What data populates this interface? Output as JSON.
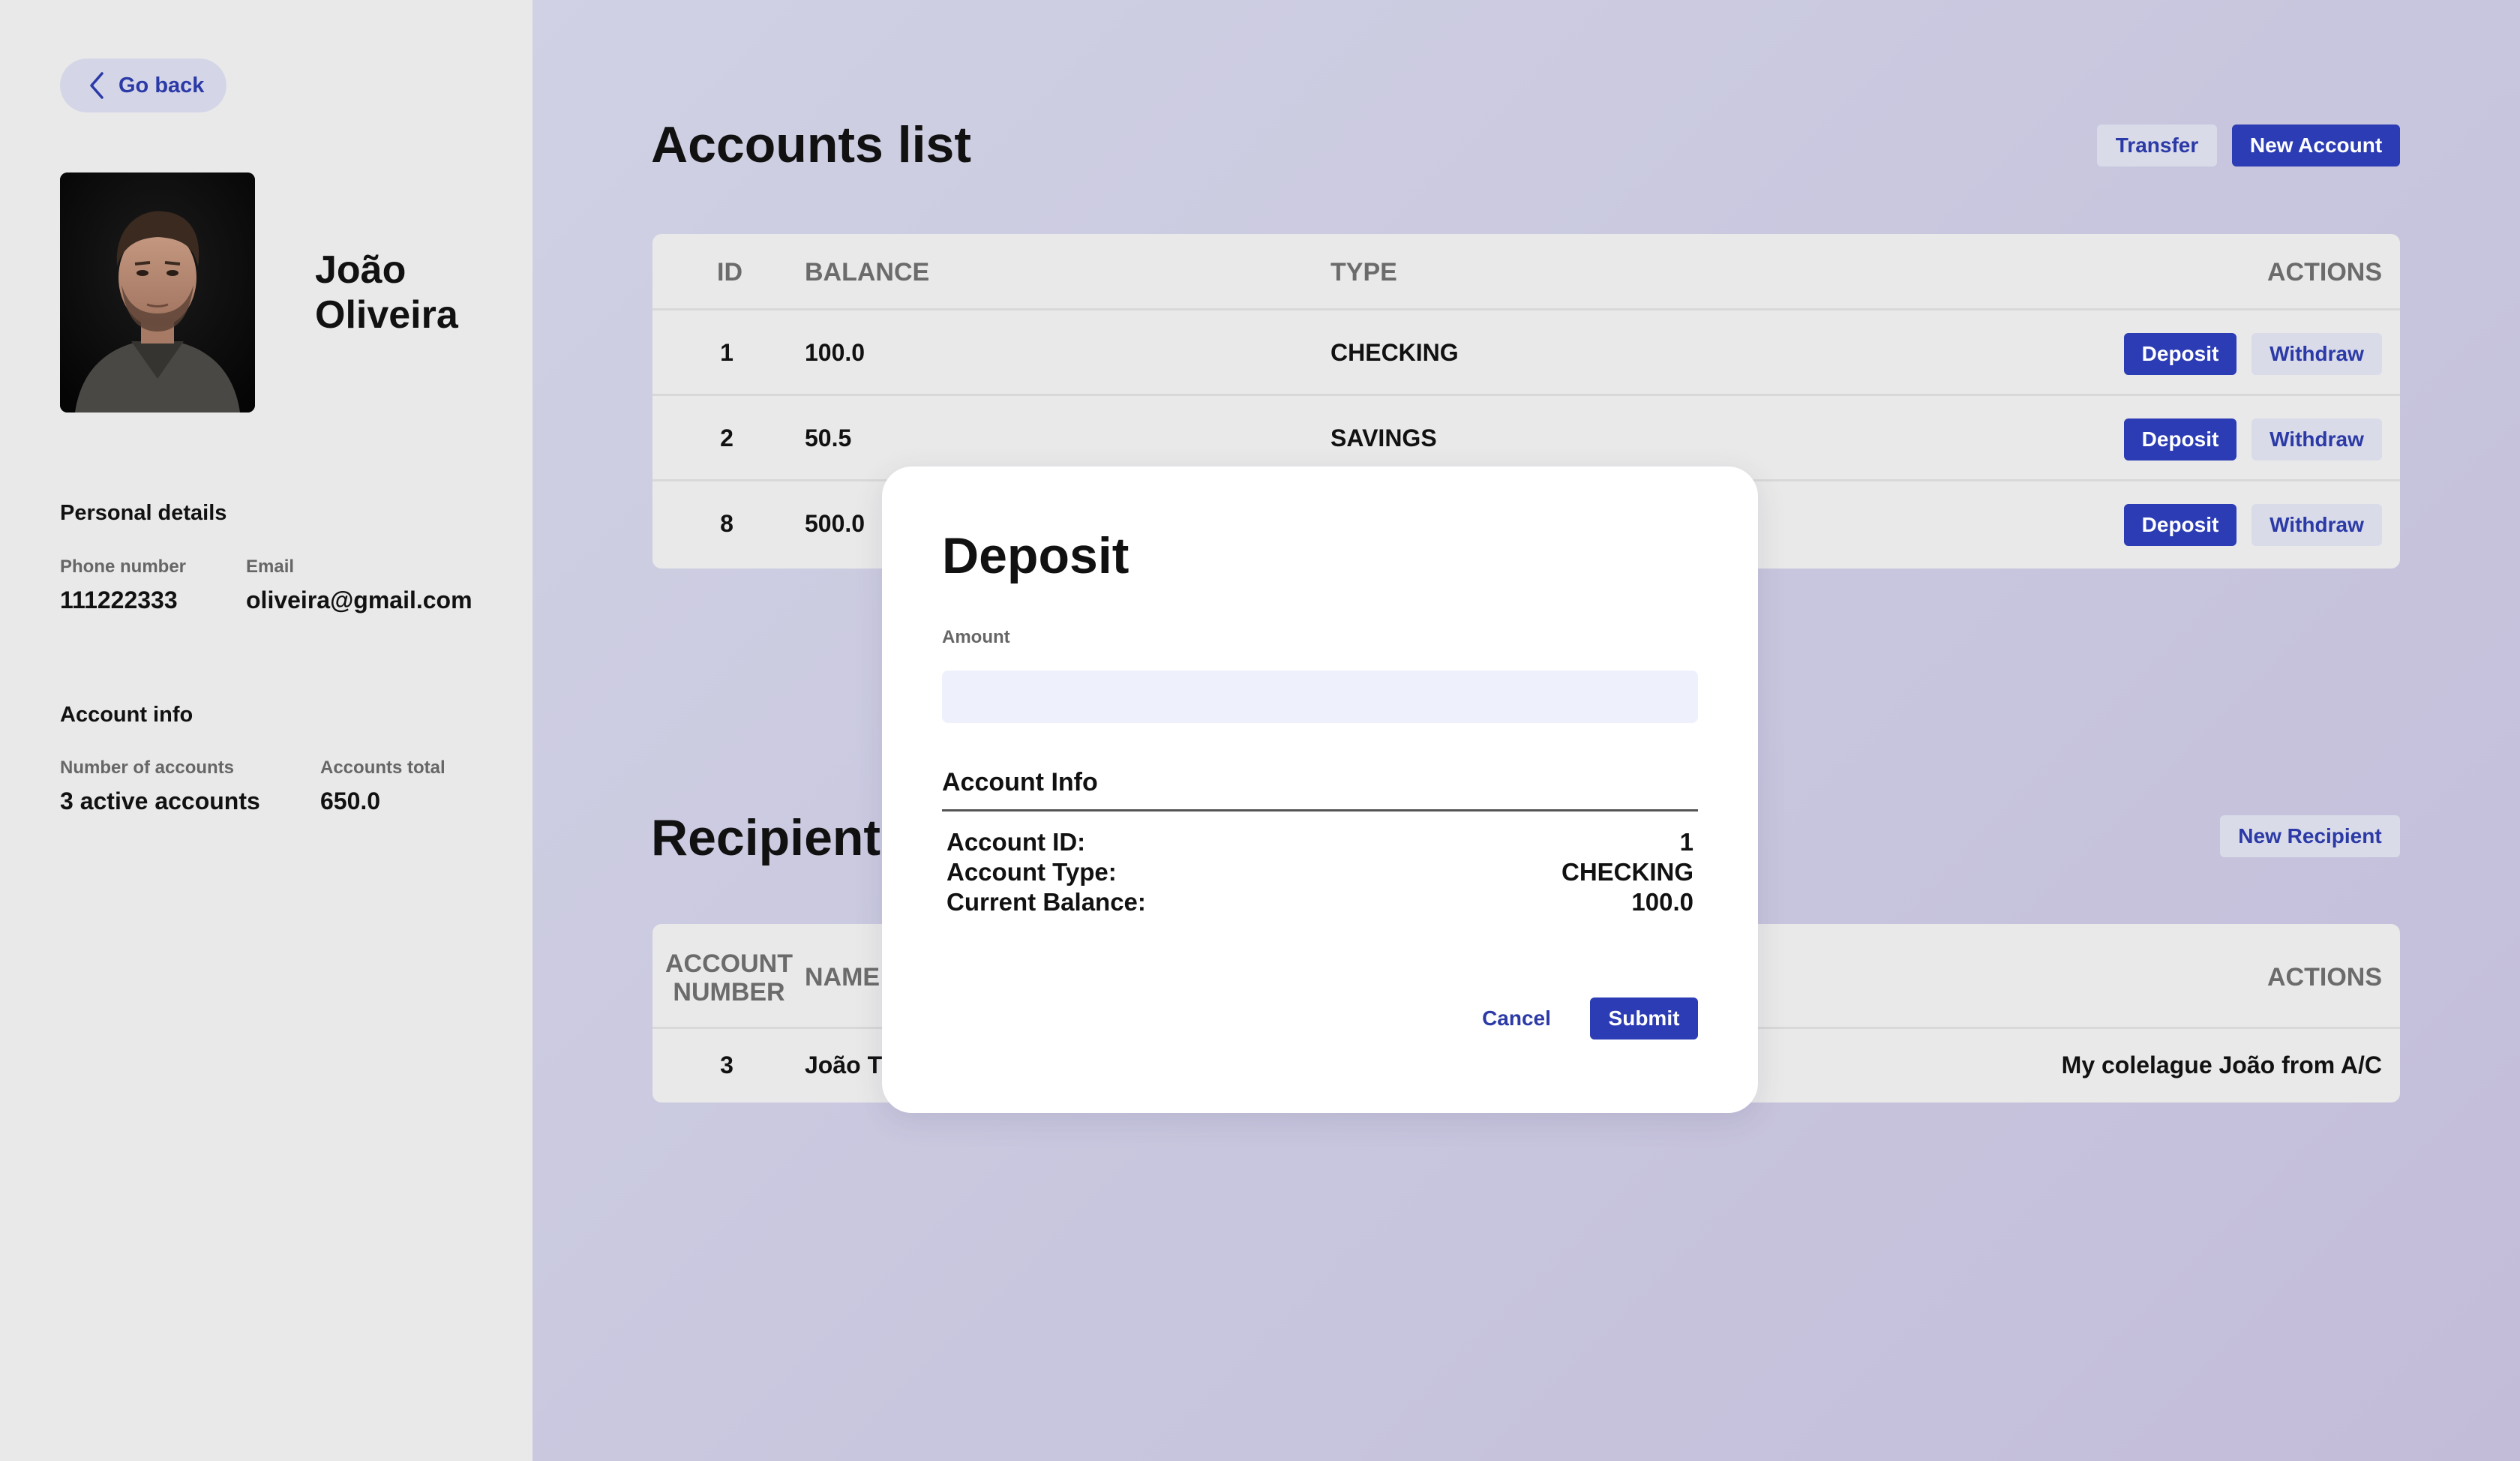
{
  "sidebar": {
    "go_back_label": "Go back",
    "user": {
      "first_name": "João",
      "last_name": "Oliveira"
    },
    "personal_details": {
      "title": "Personal details",
      "phone_label": "Phone number",
      "phone_value": "111222333",
      "email_label": "Email",
      "email_value": "oliveira@gmail.com"
    },
    "account_info": {
      "title": "Account info",
      "num_accounts_label": "Number of accounts",
      "num_accounts_value": "3 active accounts",
      "total_label": "Accounts total",
      "total_value": "650.0"
    }
  },
  "accounts": {
    "title": "Accounts list",
    "transfer_label": "Transfer",
    "new_account_label": "New Account",
    "headers": {
      "id": "ID",
      "balance": "BALANCE",
      "type": "TYPE",
      "actions": "ACTIONS"
    },
    "deposit_label": "Deposit",
    "withdraw_label": "Withdraw",
    "rows": [
      {
        "id": "1",
        "balance": "100.0",
        "type": "CHECKING"
      },
      {
        "id": "2",
        "balance": "50.5",
        "type": "SAVINGS"
      },
      {
        "id": "8",
        "balance": "500.0",
        "type": ""
      }
    ]
  },
  "recipients": {
    "title": "Recipients",
    "new_recipient_label": "New Recipient",
    "headers": {
      "account_number_1": "ACCOUNT",
      "account_number_2": "NUMBER",
      "name": "NAME",
      "actions": "ACTIONS"
    },
    "rows": [
      {
        "account_number": "3",
        "name": "João T",
        "description": "My colelague João from A/C"
      }
    ]
  },
  "modal": {
    "title": "Deposit",
    "amount_label": "Amount",
    "amount_value": "",
    "amount_placeholder": "",
    "info_title": "Account Info",
    "info": [
      {
        "label": "Account ID:",
        "value": "1"
      },
      {
        "label": "Account Type:",
        "value": "CHECKING"
      },
      {
        "label": "Current Balance:",
        "value": "100.0"
      }
    ],
    "cancel_label": "Cancel",
    "submit_label": "Submit"
  },
  "colors": {
    "accent": "#2b3cb4",
    "accent_text": "#2b3aa6",
    "sidebar_bg": "#e9e9e9",
    "table_bg": "#e9e9e9",
    "modal_bg": "#ffffff"
  },
  "icons": {
    "go_back": "chevron-left-icon"
  }
}
